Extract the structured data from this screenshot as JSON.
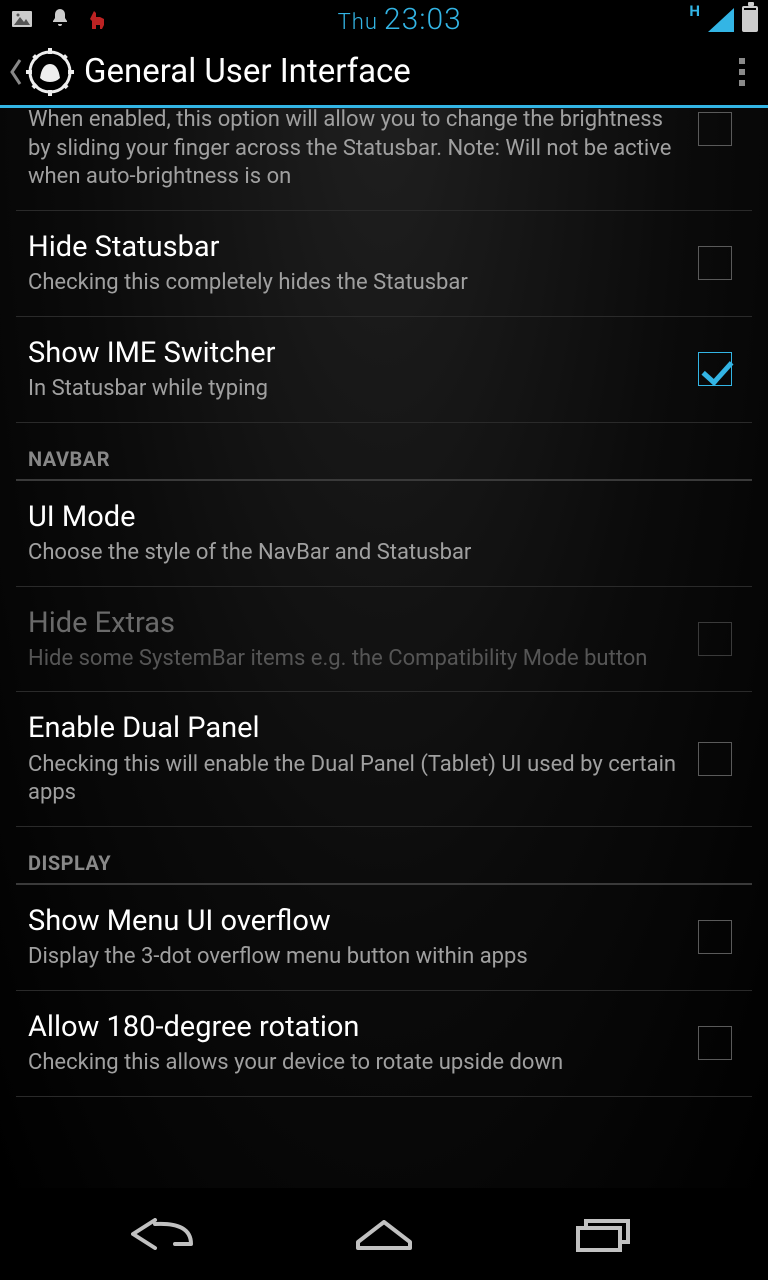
{
  "statusbar": {
    "day": "Thu",
    "time": "23:03",
    "network_label": "H"
  },
  "actionbar": {
    "title": "General User Interface"
  },
  "prefs": {
    "brightness": {
      "summary": "When enabled, this option will allow you to change the brightness by sliding your finger across the Statusbar. Note: Will not be active when auto-brightness is on"
    },
    "hide_statusbar": {
      "title": "Hide Statusbar",
      "summary": "Checking this completely hides the Statusbar"
    },
    "ime_switcher": {
      "title": "Show IME Switcher",
      "summary": "In Statusbar while typing"
    },
    "ui_mode": {
      "title": "UI Mode",
      "summary": "Choose the style of the NavBar and Statusbar"
    },
    "hide_extras": {
      "title": "Hide Extras",
      "summary": "Hide some SystemBar items e.g. the Compatibility Mode button"
    },
    "dual_panel": {
      "title": "Enable Dual Panel",
      "summary": "Checking this will enable the Dual Panel (Tablet) UI used by certain apps"
    },
    "menu_overflow": {
      "title": "Show Menu UI overflow",
      "summary": "Display the 3-dot overflow menu button within apps"
    },
    "rotation": {
      "title": "Allow 180-degree rotation",
      "summary": "Checking this allows your device to rotate upside down"
    }
  },
  "categories": {
    "navbar": "NAVBAR",
    "display": "DISPLAY"
  }
}
